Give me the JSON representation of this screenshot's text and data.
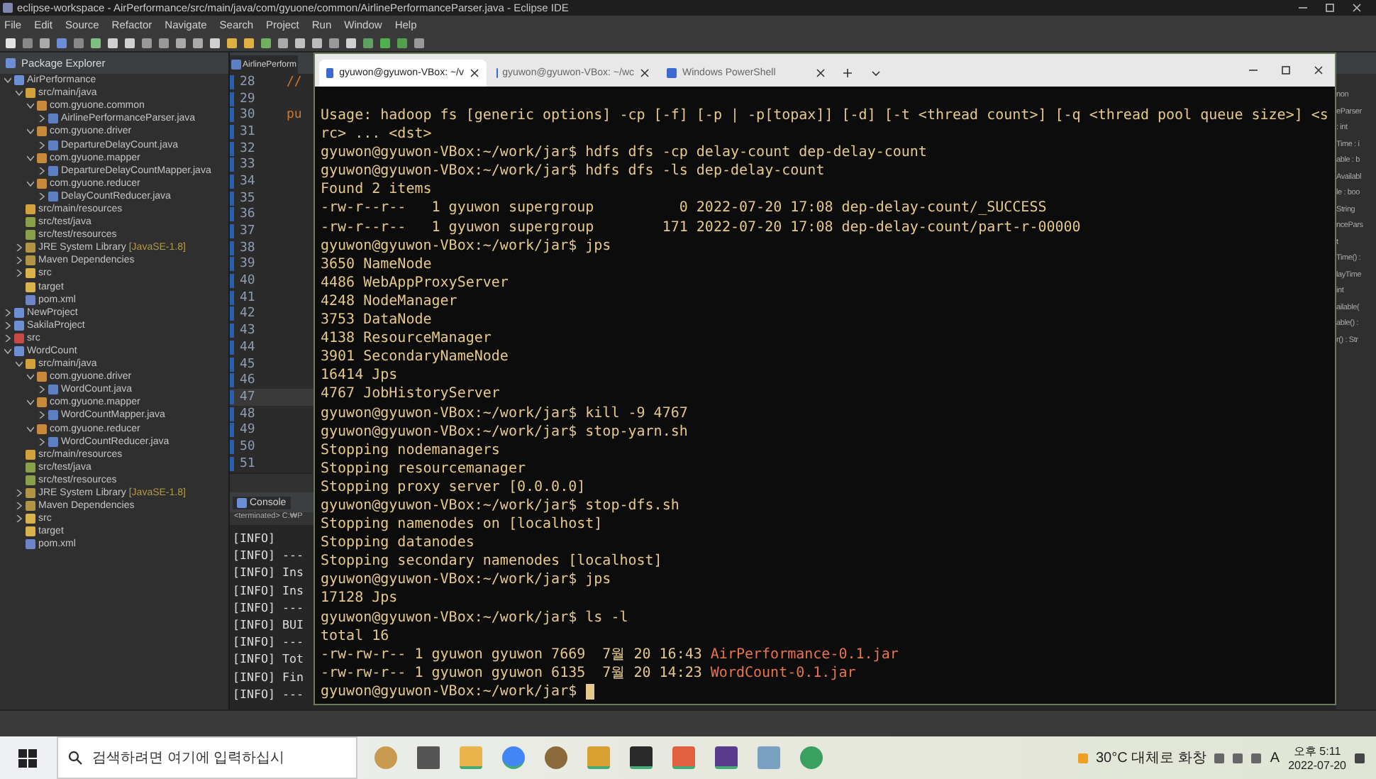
{
  "eclipse": {
    "title": "eclipse-workspace - AirPerformance/src/main/java/com/gyuone/common/AirlinePerformanceParser.java - Eclipse IDE",
    "menu": [
      "File",
      "Edit",
      "Source",
      "Refactor",
      "Navigate",
      "Search",
      "Project",
      "Run",
      "Window",
      "Help"
    ],
    "explorer": {
      "title": "Package Explorer",
      "tree": [
        {
          "label": "AirPerformance",
          "kind": "project",
          "expanded": true,
          "children": [
            {
              "label": "src/main/java",
              "kind": "srcfolder",
              "expanded": true,
              "children": [
                {
                  "label": "com.gyuone.common",
                  "kind": "package",
                  "expanded": true,
                  "children": [
                    {
                      "label": "AirlinePerformanceParser.java",
                      "kind": "file",
                      "expanded": false
                    }
                  ]
                },
                {
                  "label": "com.gyuone.driver",
                  "kind": "package",
                  "expanded": true,
                  "children": [
                    {
                      "label": "DepartureDelayCount.java",
                      "kind": "file",
                      "expanded": false
                    }
                  ]
                },
                {
                  "label": "com.gyuone.mapper",
                  "kind": "package",
                  "expanded": true,
                  "children": [
                    {
                      "label": "DepartureDelayCountMapper.java",
                      "kind": "file",
                      "expanded": false
                    }
                  ]
                },
                {
                  "label": "com.gyuone.reducer",
                  "kind": "package",
                  "expanded": true,
                  "children": [
                    {
                      "label": "DelayCountReducer.java",
                      "kind": "file",
                      "expanded": false
                    }
                  ]
                }
              ]
            },
            {
              "label": "src/main/resources",
              "kind": "srcfolder"
            },
            {
              "label": "src/test/java",
              "kind": "testfolder"
            },
            {
              "label": "src/test/resources",
              "kind": "testfolder"
            },
            {
              "label": "JRE System Library",
              "decoration": "[JavaSE-1.8]",
              "kind": "library",
              "expanded": false
            },
            {
              "label": "Maven Dependencies",
              "kind": "library",
              "expanded": false
            },
            {
              "label": "src",
              "kind": "folder",
              "expanded": false
            },
            {
              "label": "target",
              "kind": "folder"
            },
            {
              "label": "pom.xml",
              "kind": "xml"
            }
          ]
        },
        {
          "label": "NewProject",
          "kind": "project",
          "expanded": false
        },
        {
          "label": "SakilaProject",
          "kind": "project",
          "expanded": false
        },
        {
          "label": "src",
          "kind": "errproject",
          "expanded": false
        },
        {
          "label": "WordCount",
          "kind": "project",
          "expanded": true,
          "children": [
            {
              "label": "src/main/java",
              "kind": "srcfolder",
              "expanded": true,
              "children": [
                {
                  "label": "com.gyuone.driver",
                  "kind": "package",
                  "expanded": true,
                  "children": [
                    {
                      "label": "WordCount.java",
                      "kind": "file",
                      "expanded": false
                    }
                  ]
                },
                {
                  "label": "com.gyuone.mapper",
                  "kind": "package",
                  "expanded": true,
                  "children": [
                    {
                      "label": "WordCountMapper.java",
                      "kind": "file",
                      "expanded": false
                    }
                  ]
                },
                {
                  "label": "com.gyuone.reducer",
                  "kind": "package",
                  "expanded": true,
                  "children": [
                    {
                      "label": "WordCountReducer.java",
                      "kind": "file",
                      "expanded": false
                    }
                  ]
                }
              ]
            },
            {
              "label": "src/main/resources",
              "kind": "srcfolder"
            },
            {
              "label": "src/test/java",
              "kind": "testfolder"
            },
            {
              "label": "src/test/resources",
              "kind": "testfolder"
            },
            {
              "label": "JRE System Library",
              "decoration": "[JavaSE-1.8]",
              "kind": "library",
              "expanded": false
            },
            {
              "label": "Maven Dependencies",
              "kind": "library",
              "expanded": false
            },
            {
              "label": "src",
              "kind": "folder",
              "expanded": false
            },
            {
              "label": "target",
              "kind": "folder"
            },
            {
              "label": "pom.xml",
              "kind": "xml"
            }
          ]
        }
      ]
    },
    "editor": {
      "tab": "AirlinePerform",
      "lines": [
        {
          "number": "28",
          "code": "//",
          "current": false
        },
        {
          "number": "29",
          "current": false
        },
        {
          "number": "30",
          "code": "pu",
          "current": false
        },
        {
          "number": "31",
          "current": false
        },
        {
          "number": "32",
          "current": false
        },
        {
          "number": "33",
          "current": false
        },
        {
          "number": "34",
          "current": false
        },
        {
          "number": "35",
          "current": false
        },
        {
          "number": "36",
          "current": false
        },
        {
          "number": "37",
          "current": false
        },
        {
          "number": "38",
          "current": false
        },
        {
          "number": "39",
          "current": false
        },
        {
          "number": "40",
          "current": false
        },
        {
          "number": "41",
          "current": false
        },
        {
          "number": "42",
          "current": false
        },
        {
          "number": "43",
          "current": false
        },
        {
          "number": "44",
          "current": false
        },
        {
          "number": "45",
          "current": false
        },
        {
          "number": "46",
          "current": false
        },
        {
          "number": "47",
          "current": true
        },
        {
          "number": "48",
          "current": false
        },
        {
          "number": "49",
          "current": false
        },
        {
          "number": "50",
          "current": false
        },
        {
          "number": "51",
          "current": false
        }
      ]
    },
    "console": {
      "tab": "Console",
      "status": "<terminated> C:₩P",
      "lines": [
        "[INFO]",
        "[INFO] ---",
        "[INFO] Ins",
        "[INFO] Ins",
        "[INFO] ---",
        "[INFO] BUI",
        "[INFO] ---",
        "[INFO] Tot",
        "[INFO] Fin",
        "[INFO] ---"
      ]
    },
    "outline": [
      "non",
      "eParser",
      ": int",
      "Time : i",
      "able : b",
      "Availabl",
      "le : boo",
      "String",
      "ncePars",
      "t",
      "Time() :",
      "layTime",
      "int",
      "ailable(",
      "able() :",
      "r() : Str"
    ]
  },
  "terminal": {
    "tabs": [
      {
        "label": "gyuwon@gyuwon-VBox: ~/v",
        "selected": true
      },
      {
        "label": "gyuwon@gyuwon-VBox: ~/wc",
        "selected": false
      },
      {
        "label": "Windows PowerShell",
        "selected": false
      }
    ],
    "lines": [
      {
        "text": "Usage: hadoop fs [generic options] -cp [-f] [-p | -p[topax]] [-d] [-t <thread count>] [-q <thread pool queue size>] <s"
      },
      {
        "text": "rc> ... <dst>"
      },
      {
        "text": "gyuwon@gyuwon-VBox:~/work/jar$ hdfs dfs -cp delay-count dep-delay-count"
      },
      {
        "text": "gyuwon@gyuwon-VBox:~/work/jar$ hdfs dfs -ls dep-delay-count"
      },
      {
        "text": "Found 2 items"
      },
      {
        "text": "-rw-r--r--   1 gyuwon supergroup          0 2022-07-20 17:08 dep-delay-count/_SUCCESS"
      },
      {
        "text": "-rw-r--r--   1 gyuwon supergroup        171 2022-07-20 17:08 dep-delay-count/part-r-00000"
      },
      {
        "text": "gyuwon@gyuwon-VBox:~/work/jar$ jps"
      },
      {
        "text": "3650 NameNode"
      },
      {
        "text": "4486 WebAppProxyServer"
      },
      {
        "text": "4248 NodeManager"
      },
      {
        "text": "3753 DataNode"
      },
      {
        "text": "4138 ResourceManager"
      },
      {
        "text": "3901 SecondaryNameNode"
      },
      {
        "text": "16414 Jps"
      },
      {
        "text": "4767 JobHistoryServer"
      },
      {
        "text": "gyuwon@gyuwon-VBox:~/work/jar$ kill -9 4767"
      },
      {
        "text": "gyuwon@gyuwon-VBox:~/work/jar$ stop-yarn.sh"
      },
      {
        "text": "Stopping nodemanagers"
      },
      {
        "text": "Stopping resourcemanager"
      },
      {
        "text": "Stopping proxy server [0.0.0.0]"
      },
      {
        "text": "gyuwon@gyuwon-VBox:~/work/jar$ stop-dfs.sh"
      },
      {
        "text": "Stopping namenodes on [localhost]"
      },
      {
        "text": "Stopping datanodes"
      },
      {
        "text": "Stopping secondary namenodes [localhost]"
      },
      {
        "text": "gyuwon@gyuwon-VBox:~/work/jar$ jps"
      },
      {
        "text": "17128 Jps"
      },
      {
        "text": "gyuwon@gyuwon-VBox:~/work/jar$ ls -l"
      },
      {
        "text": "total 16"
      },
      {
        "text": "-rw-rw-r-- 1 gyuwon gyuwon 7669  7월 20 16:43 ",
        "file": "AirPerformance-0.1.jar"
      },
      {
        "text": "-rw-rw-r-- 1 gyuwon gyuwon 6135  7월 20 14:23 ",
        "file": "WordCount-0.1.jar"
      },
      {
        "text": "gyuwon@gyuwon-VBox:~/work/jar$ ",
        "cursor": true
      }
    ]
  },
  "taskbar": {
    "search": {
      "placeholder": "검색하려면 여기에 입력하십시"
    },
    "weather": "30°C 대체로 화창",
    "ime": "A",
    "time": "오후 5:11",
    "date": "2022-07-20"
  }
}
